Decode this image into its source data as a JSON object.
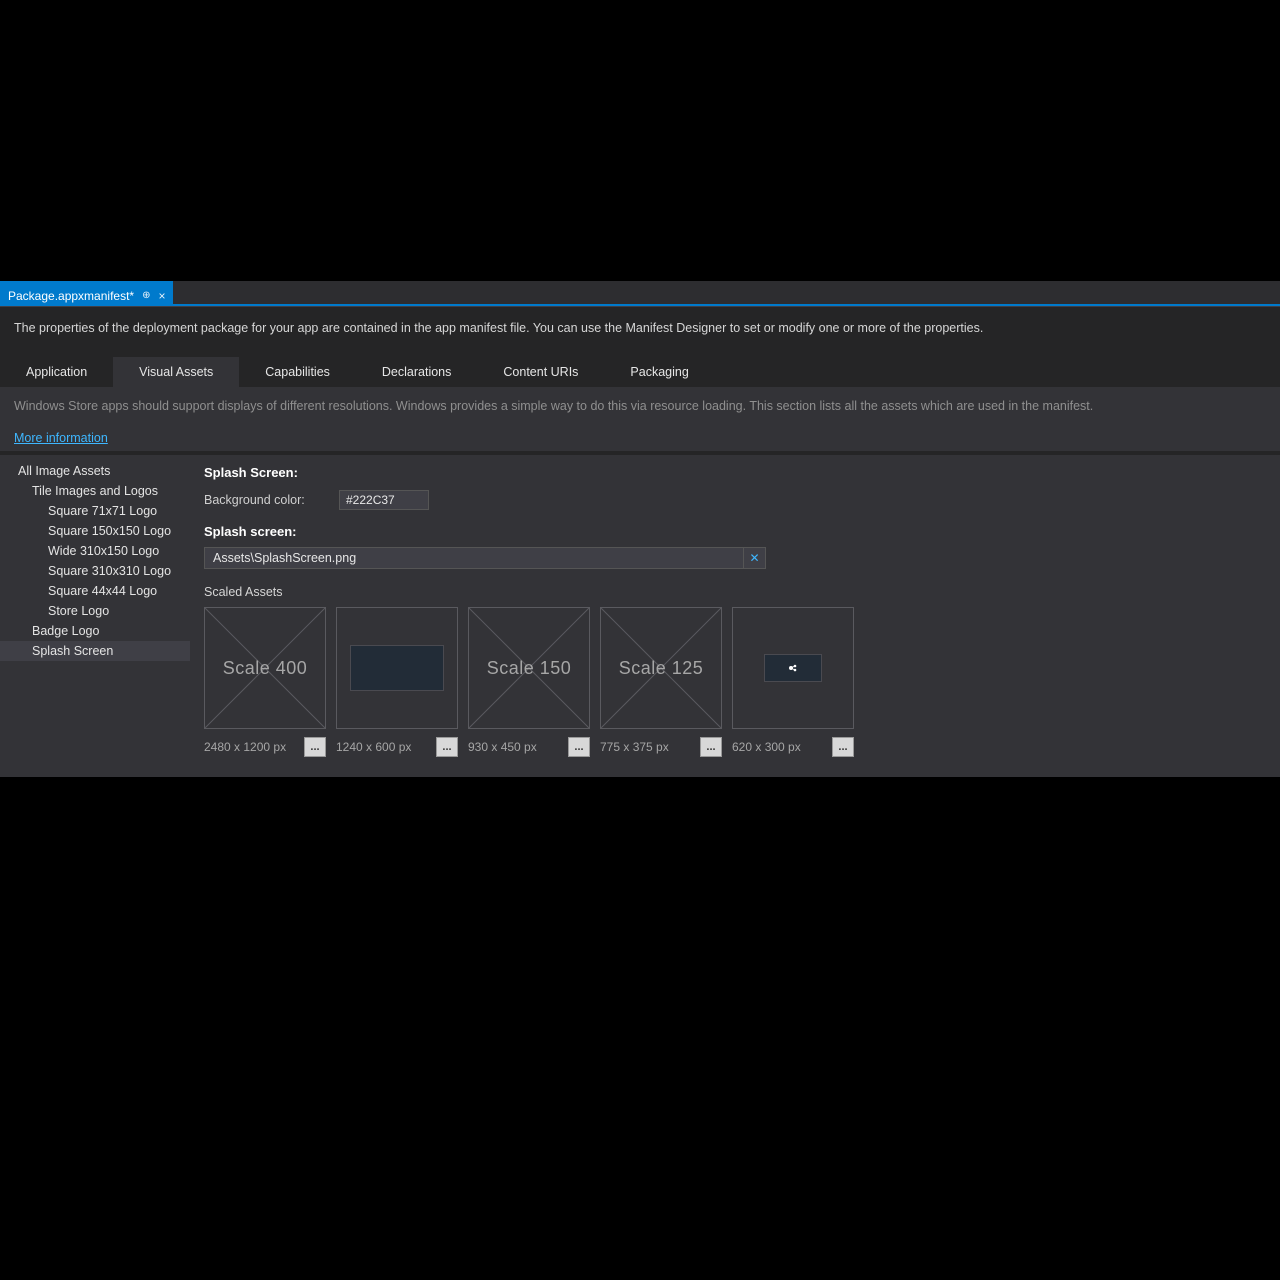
{
  "document_tab": {
    "title": "Package.appxmanifest*",
    "pin_glyph": "⊕",
    "close_glyph": "×"
  },
  "intro": "The properties of the deployment package for your app are contained in the app manifest file. You can use the Manifest Designer to set or modify one or more of the properties.",
  "tabs": [
    {
      "label": "Application"
    },
    {
      "label": "Visual Assets",
      "active": true
    },
    {
      "label": "Capabilities"
    },
    {
      "label": "Declarations"
    },
    {
      "label": "Content URIs"
    },
    {
      "label": "Packaging"
    }
  ],
  "sub_intro": "Windows Store apps should support displays of different resolutions. Windows provides a simple way to do this via resource loading. This section lists all the assets which are used in the manifest.",
  "more_link": "More information",
  "sidebar": [
    {
      "label": "All Image Assets",
      "level": 0
    },
    {
      "label": "Tile Images and Logos",
      "level": 1
    },
    {
      "label": "Square 71x71 Logo",
      "level": 2
    },
    {
      "label": "Square 150x150 Logo",
      "level": 2
    },
    {
      "label": "Wide 310x150 Logo",
      "level": 2
    },
    {
      "label": "Square 310x310 Logo",
      "level": 2
    },
    {
      "label": "Square 44x44 Logo",
      "level": 2
    },
    {
      "label": "Store Logo",
      "level": 2
    },
    {
      "label": "Badge Logo",
      "level": 1
    },
    {
      "label": "Splash Screen",
      "level": 1,
      "selected": true
    }
  ],
  "main": {
    "section1_title": "Splash Screen:",
    "bg_label": "Background color:",
    "bg_value": "#222C37",
    "section2_title": "Splash screen:",
    "path_value": "Assets\\SplashScreen.png",
    "clear_glyph": "✕",
    "scaled_label": "Scaled Assets",
    "thumbs": [
      {
        "scale_text": "Scale 400",
        "dim": "2480 x 1200 px",
        "empty": true
      },
      {
        "scale_text": "",
        "dim": "1240 x 600 px",
        "preview": "big"
      },
      {
        "scale_text": "Scale 150",
        "dim": "930 x 450 px",
        "empty": true
      },
      {
        "scale_text": "Scale 125",
        "dim": "775 x 375 px",
        "empty": true
      },
      {
        "scale_text": "",
        "dim": "620 x 300 px",
        "preview": "small"
      }
    ],
    "browse_glyph": "..."
  }
}
